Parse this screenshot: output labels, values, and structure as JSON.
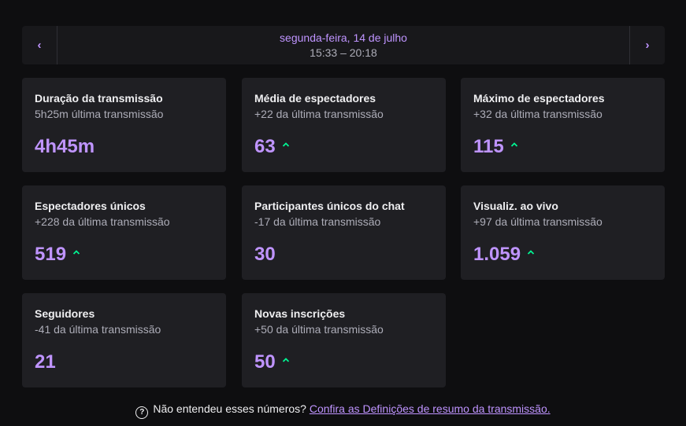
{
  "colors": {
    "background": "#0e0e10",
    "card": "#1f1f23",
    "accent": "#bf94ff",
    "increase": "#00f593",
    "muted": "#adadb8"
  },
  "nav": {
    "prev_icon": "chevron-left-icon",
    "next_icon": "chevron-right-icon",
    "date": "segunda-feira, 14 de julho",
    "time": "15:33 – 20:18"
  },
  "cards": [
    {
      "title": "Duração da transmissão",
      "subtitle": "5h25m última transmissão",
      "value": "4h45m",
      "increase": false
    },
    {
      "title": "Média de espectadores",
      "subtitle": "+22 da última transmissão",
      "value": "63",
      "increase": true
    },
    {
      "title": "Máximo de espectadores",
      "subtitle": "+32 da última transmissão",
      "value": "115",
      "increase": true
    },
    {
      "title": "Espectadores únicos",
      "subtitle": "+228 da última transmissão",
      "value": "519",
      "increase": true
    },
    {
      "title": "Participantes únicos do chat",
      "subtitle": "-17 da última transmissão",
      "value": "30",
      "increase": false
    },
    {
      "title": "Visualiz. ao vivo",
      "subtitle": "+97 da última transmissão",
      "value": "1.059",
      "increase": true
    },
    {
      "title": "Seguidores",
      "subtitle": "-41 da última transmissão",
      "value": "21",
      "increase": false
    },
    {
      "title": "Novas inscrições",
      "subtitle": "+50 da última transmissão",
      "value": "50",
      "increase": true
    }
  ],
  "footer": {
    "help_icon": "question-circle-icon",
    "question": "Não entendeu esses números?",
    "link": "Confira as Definições de resumo da transmissão."
  }
}
